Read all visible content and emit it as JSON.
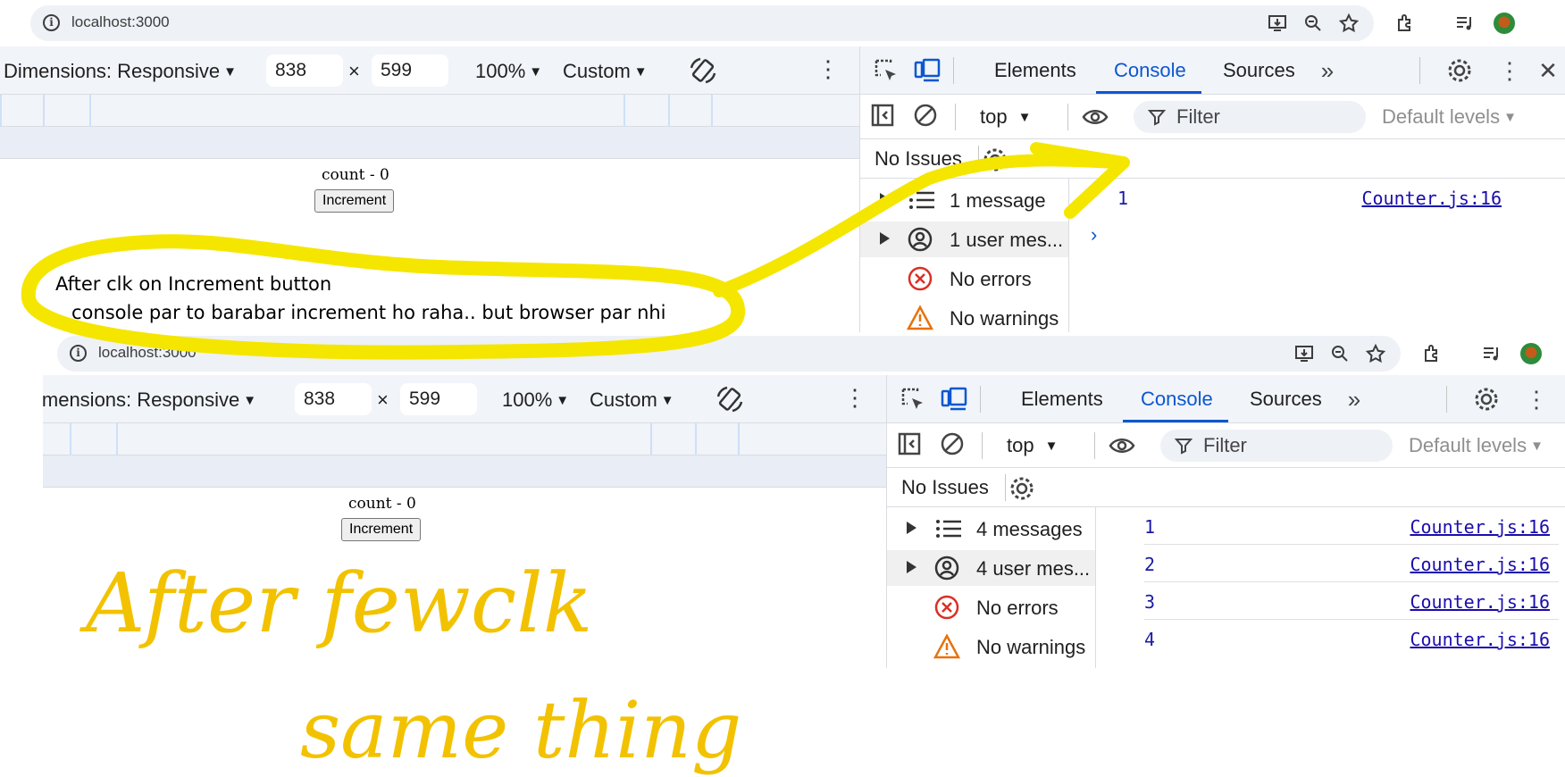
{
  "top_capture": {
    "browser": {
      "url": "localhost:3000"
    },
    "device_toolbar": {
      "dimensions_label": "Dimensions: Responsive",
      "width": "838",
      "times": "×",
      "height": "599",
      "zoom": "100%",
      "throttle": "Custom"
    },
    "page": {
      "count_text": "count - 0",
      "button_label": "Increment"
    },
    "devtools": {
      "tabs": [
        "Elements",
        "Console",
        "Sources"
      ],
      "active_tab": "Console",
      "context": "top",
      "filter_placeholder": "Filter",
      "levels": "Default levels",
      "issues": "No Issues",
      "sidebar": [
        "1 message",
        "1 user mes...",
        "No errors",
        "No warnings"
      ],
      "messages": [
        {
          "value": "1",
          "source": "Counter.js:16"
        }
      ]
    },
    "annotation": {
      "line1": "After clk on Increment button",
      "line2": "console par to barabar increment ho raha.. but browser par nhi"
    }
  },
  "bottom_capture": {
    "browser": {
      "url": "localhost:3000"
    },
    "device_toolbar": {
      "dimensions_label": "imensions: Responsive",
      "width": "838",
      "times": "×",
      "height": "599",
      "zoom": "100%",
      "throttle": "Custom"
    },
    "page": {
      "count_text": "count - 0",
      "button_label": "Increment"
    },
    "devtools": {
      "tabs": [
        "Elements",
        "Console",
        "Sources"
      ],
      "active_tab": "Console",
      "context": "top",
      "filter_placeholder": "Filter",
      "levels": "Default levels",
      "issues": "No Issues",
      "sidebar": [
        "4 messages",
        "4 user mes...",
        "No errors",
        "No warnings"
      ],
      "messages": [
        {
          "value": "1",
          "source": "Counter.js:16"
        },
        {
          "value": "2",
          "source": "Counter.js:16"
        },
        {
          "value": "3",
          "source": "Counter.js:16"
        },
        {
          "value": "4",
          "source": "Counter.js:16"
        }
      ]
    },
    "handwriting": {
      "line1": "After fewclk",
      "line2": "same thing"
    }
  },
  "colors": {
    "accent": "#0b57d0",
    "highlight": "#f5e600",
    "handwriting": "#f2c200"
  }
}
